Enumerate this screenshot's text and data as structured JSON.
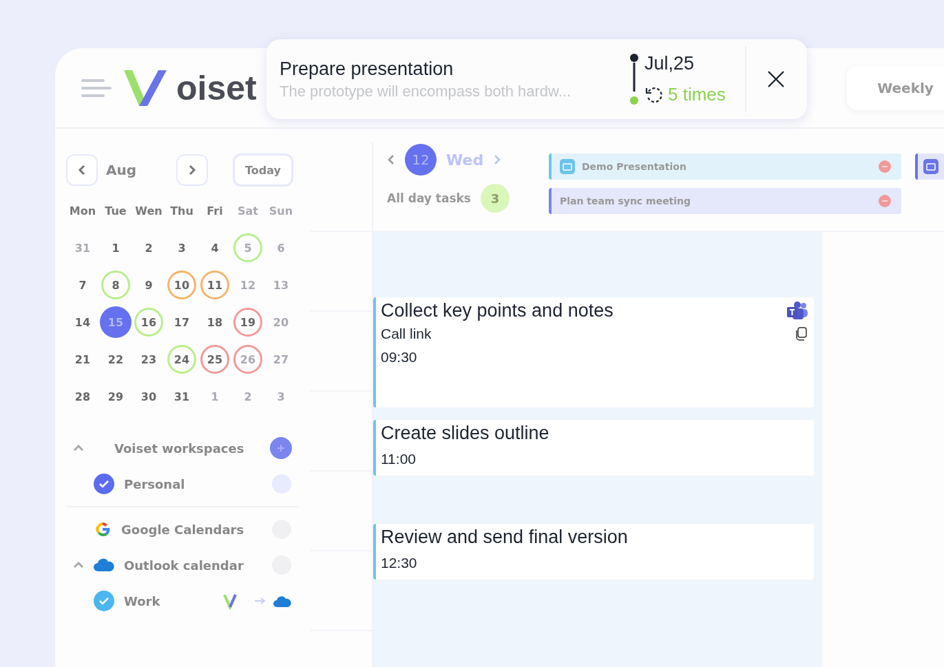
{
  "header": {
    "logo": "oiset",
    "view_button": "Weekly"
  },
  "mini_calendar": {
    "month": "Aug",
    "today_button": "Today",
    "weekdays": [
      {
        "label": "Mon",
        "muted": false
      },
      {
        "label": "Tue",
        "muted": false
      },
      {
        "label": "Wen",
        "muted": false
      },
      {
        "label": "Thu",
        "muted": false
      },
      {
        "label": "Fri",
        "muted": false
      },
      {
        "label": "Sat",
        "muted": true
      },
      {
        "label": "Sun",
        "muted": true
      }
    ],
    "days": [
      {
        "label": "31",
        "muted": true,
        "selected": false
      },
      {
        "label": "1",
        "muted": false,
        "selected": false
      },
      {
        "label": "2",
        "muted": false,
        "selected": false
      },
      {
        "label": "3",
        "muted": false,
        "selected": false
      },
      {
        "label": "4",
        "muted": false,
        "selected": false
      },
      {
        "label": "5",
        "muted": true,
        "selected": false,
        "color": "#b9ee8c"
      },
      {
        "label": "6",
        "muted": true,
        "selected": false
      },
      {
        "label": "7",
        "muted": false,
        "selected": false
      },
      {
        "label": "8",
        "muted": false,
        "selected": false,
        "color": "#b9ee8c"
      },
      {
        "label": "9",
        "muted": false,
        "selected": false
      },
      {
        "label": "10",
        "muted": false,
        "selected": false,
        "color": "#f5b56a"
      },
      {
        "label": "11",
        "muted": false,
        "selected": false,
        "color": "#f5b56a"
      },
      {
        "label": "12",
        "muted": true,
        "selected": false
      },
      {
        "label": "13",
        "muted": true,
        "selected": false
      },
      {
        "label": "14",
        "muted": false,
        "selected": false
      },
      {
        "label": "15",
        "muted": false,
        "selected": true
      },
      {
        "label": "16",
        "muted": false,
        "selected": false,
        "color": "#b9ee8c"
      },
      {
        "label": "17",
        "muted": false,
        "selected": false
      },
      {
        "label": "18",
        "muted": false,
        "selected": false
      },
      {
        "label": "19",
        "muted": false,
        "selected": false,
        "color": "#f09a9a"
      },
      {
        "label": "20",
        "muted": true,
        "selected": false
      },
      {
        "label": "21",
        "muted": false,
        "selected": false
      },
      {
        "label": "22",
        "muted": false,
        "selected": false
      },
      {
        "label": "23",
        "muted": false,
        "selected": false
      },
      {
        "label": "24",
        "muted": false,
        "selected": false,
        "color": "#b9ee8c"
      },
      {
        "label": "25",
        "muted": false,
        "selected": false,
        "color": "#f09a9a"
      },
      {
        "label": "26",
        "muted": true,
        "selected": false,
        "color": "#f09a9a"
      },
      {
        "label": "27",
        "muted": true,
        "selected": false
      },
      {
        "label": "28",
        "muted": false,
        "selected": false
      },
      {
        "label": "29",
        "muted": false,
        "selected": false
      },
      {
        "label": "30",
        "muted": false,
        "selected": false
      },
      {
        "label": "31",
        "muted": false,
        "selected": false
      },
      {
        "label": "1",
        "muted": true,
        "selected": false
      },
      {
        "label": "2",
        "muted": true,
        "selected": false
      },
      {
        "label": "3",
        "muted": true,
        "selected": false
      }
    ]
  },
  "calendars": [
    {
      "kind": "group",
      "label": "Voiset workspaces",
      "expanded": true
    },
    {
      "kind": "calendar",
      "label": "Personal",
      "checked": true,
      "color": "#5b6cf0"
    },
    {
      "kind": "google",
      "label": "Google Calendars"
    },
    {
      "kind": "outlook",
      "label": "Outlook calendar",
      "expanded": true
    },
    {
      "kind": "synced",
      "label": "Work",
      "checked": true,
      "color": "#4cb6f0"
    }
  ],
  "day_view": {
    "day_number": "12",
    "weekday": "Wed",
    "all_day_label": "All day tasks",
    "all_day_count": "3",
    "all_day_events": [
      {
        "title": "Demo Presentation",
        "color": "#6cc4ef",
        "has_icon": true
      },
      {
        "title": "Plan team sync meeting",
        "color": "#7a83ea",
        "has_icon": false
      }
    ],
    "events": [
      {
        "title": "Collect key points and notes",
        "link": "Call link",
        "time": "09:30"
      },
      {
        "title": "Create slides outline",
        "time": "11:00"
      },
      {
        "title": "Review and send final version",
        "time": "12:30"
      }
    ]
  },
  "popup": {
    "title": "Prepare presentation",
    "description": "The prototype will encompass both hardw...",
    "date": "Jul,25",
    "repeat": "5 times"
  }
}
